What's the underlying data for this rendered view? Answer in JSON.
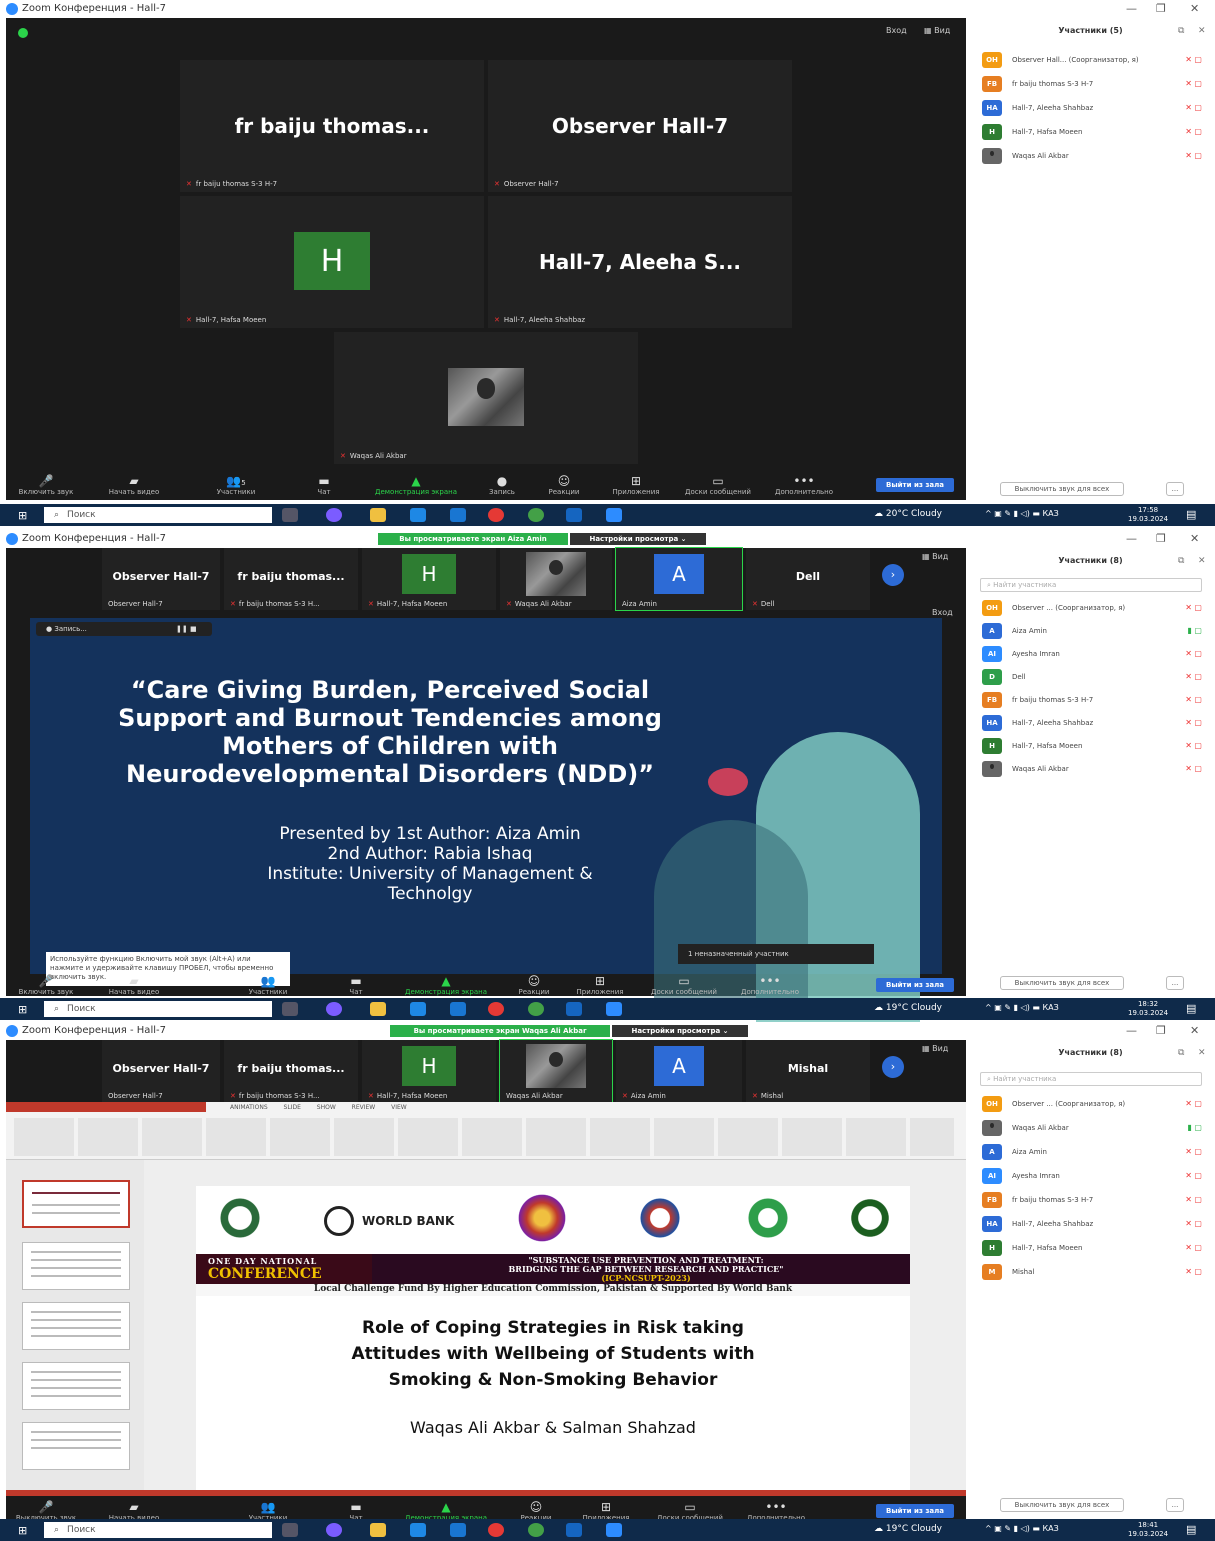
{
  "panels": [
    {
      "window_title": "Zoom Конференция - Hall-7",
      "top_right": {
        "enter": "Вход",
        "view": "Вид"
      },
      "tiles": [
        {
          "big": "fr  baiju thomas...",
          "caption": "fr baiju thomas  S-3 H-7"
        },
        {
          "big": "Observer Hall-7",
          "caption": "Observer Hall-7"
        },
        {
          "avatar": "H",
          "caption": "Hall-7, Hafsa Moeen"
        },
        {
          "big": "Hall-7, Aleeha S...",
          "caption": "Hall-7, Aleeha Shahbaz"
        },
        {
          "photo": true,
          "caption": "Waqas Ali Akbar"
        }
      ],
      "toolbar": {
        "items": [
          "Включить звук",
          "Начать видео",
          "Участники",
          "Чат",
          "Демонстрация экрана",
          "Запись",
          "Реакции",
          "Приложения",
          "Доски сообщений",
          "Дополнительно"
        ],
        "participants_count": "5",
        "leave": "Выйти из зала"
      },
      "sidebar": {
        "title": "Участники (5)",
        "participants": [
          {
            "initials": "OH",
            "color": "#f39c12",
            "name": "Observer Hall... (Соорганизатор, я)"
          },
          {
            "initials": "FB",
            "color": "#e67e22",
            "name": "fr baiju thomas  S-3 H-7"
          },
          {
            "initials": "HA",
            "color": "#2d6bd6",
            "name": "Hall-7, Aleeha Shahbaz"
          },
          {
            "initials": "H",
            "color": "#2e7d32",
            "name": "Hall-7, Hafsa Moeen"
          },
          {
            "initials": "",
            "color": "#666",
            "name": "Waqas Ali Akbar"
          }
        ],
        "mute_all": "Выключить звук для всех",
        "more": "..."
      },
      "taskbar": {
        "search": "Поиск",
        "weather": "20°C  Cloudy",
        "lang": "КАЗ",
        "time": "17:58",
        "date": "19.03.2024"
      }
    },
    {
      "window_title": "Zoom Конференция - Hall-7",
      "viewing_banner": "Вы просматриваете экран Aiza Amin",
      "view_options": "Настройки просмотра",
      "view": "Вид",
      "strip": [
        {
          "name": "Observer Hall-7",
          "caption": "Observer Hall-7"
        },
        {
          "name": "fr  baiju thomas...",
          "caption": "fr baiju thomas  S-3 H..."
        },
        {
          "avatar": "H",
          "caption": "Hall-7, Hafsa Moeen"
        },
        {
          "photo": true,
          "caption": "Waqas Ali Akbar"
        },
        {
          "avatar": "A",
          "caption": "Aiza Amin"
        },
        {
          "name": "Dell",
          "caption": "Dell"
        }
      ],
      "recording": "Запись...",
      "enter": "Вход",
      "slide": {
        "lines": [
          "“Care Giving Burden, Perceived Social",
          "Support and Burnout Tendencies among",
          "Mothers of Children with",
          "Neurodevelopmental Disorders (NDD)”"
        ],
        "sub": [
          "Presented by 1st Author: Aiza Amin",
          "2nd Author: Rabia Ishaq",
          "Institute: University of Management &",
          "Technolgy"
        ]
      },
      "hint": "Используйте функцию Включить мой звук (Alt+A) или нажмите и удерживайте клавишу ПРОБЕЛ, чтобы временно включить звук.",
      "unassigned": "1 неназначенный участник",
      "toolbar": {
        "items": [
          "Включить звук",
          "Начать видео",
          "Участники",
          "Чат",
          "Демонстрация экрана",
          "Реакции",
          "Приложения",
          "Доски сообщений",
          "Дополнительно"
        ],
        "leave": "Выйти из зала"
      },
      "sidebar": {
        "title": "Участники (8)",
        "search": "Найти участника",
        "participants": [
          {
            "initials": "OH",
            "color": "#f39c12",
            "name": "Observer ... (Соорганизатор, я)"
          },
          {
            "initials": "A",
            "color": "#2d6bd6",
            "name": "Aiza Amin"
          },
          {
            "initials": "AI",
            "color": "#2d8cff",
            "name": "Ayesha Imran"
          },
          {
            "initials": "D",
            "color": "#2e9e4a",
            "name": "Dell"
          },
          {
            "initials": "FB",
            "color": "#e67e22",
            "name": "fr baiju thomas  S-3 H-7"
          },
          {
            "initials": "HA",
            "color": "#2d6bd6",
            "name": "Hall-7, Aleeha Shahbaz"
          },
          {
            "initials": "H",
            "color": "#2e7d32",
            "name": "Hall-7, Hafsa Moeen"
          },
          {
            "initials": "",
            "color": "#666",
            "name": "Waqas Ali Akbar"
          }
        ],
        "mute_all": "Выключить звук для всех",
        "more": "..."
      },
      "taskbar": {
        "search": "Поиск",
        "weather": "19°C  Cloudy",
        "lang": "КАЗ",
        "time": "18:32",
        "date": "19.03.2024"
      }
    },
    {
      "window_title": "Zoom Конференция - Hall-7",
      "viewing_banner": "Вы просматриваете экран Waqas Ali Akbar",
      "view_options": "Настройки просмотра",
      "view": "Вид",
      "strip": [
        {
          "name": "Observer Hall-7",
          "caption": "Observer Hall-7"
        },
        {
          "name": "fr  baiju thomas...",
          "caption": "fr baiju thomas  S-3 H..."
        },
        {
          "avatar": "H",
          "caption": "Hall-7, Hafsa Moeen"
        },
        {
          "photo": true,
          "caption": "Waqas Ali Akbar"
        },
        {
          "avatar": "A",
          "caption": "Aiza Amin"
        },
        {
          "name": "Mishal",
          "caption": "Mishal"
        }
      ],
      "ppt_tabs": "ANIMATIONS SLIDE SHOW REVIEW VIEW",
      "slide": {
        "logo_text": "WORLD BANK",
        "conf_a": "ONE DAY NATIONAL",
        "conf_b": "CONFERENCE",
        "conf_r1": "\"SUBSTANCE USE PREVENTION AND TREATMENT:",
        "conf_r2": "BRIDGING THE GAP BETWEEN RESEARCH AND PRACTICE\"",
        "conf_r3": "(ICP-NCSUPT-2023)",
        "fund": "Local Challenge Fund By Higher Education Commission, Pakistan & Supported By World Bank",
        "title": [
          "Role of Coping Strategies in Risk taking",
          "Attitudes with Wellbeing of Students with",
          "Smoking & Non-Smoking Behavior"
        ],
        "authors": "Waqas Ali Akbar & Salman Shahzad"
      },
      "toolbar": {
        "items": [
          "Выключить звук",
          "Начать видео",
          "Участники",
          "Чат",
          "Демонстрация экрана",
          "Реакции",
          "Приложения",
          "Доски сообщений",
          "Дополнительно"
        ],
        "leave": "Выйти из зала"
      },
      "sidebar": {
        "title": "Участники (8)",
        "search": "Найти участника",
        "participants": [
          {
            "initials": "OH",
            "color": "#f39c12",
            "name": "Observer ... (Соорганизатор, я)"
          },
          {
            "initials": "",
            "color": "#666",
            "name": "Waqas Ali Akbar"
          },
          {
            "initials": "A",
            "color": "#2d6bd6",
            "name": "Aiza Amin"
          },
          {
            "initials": "AI",
            "color": "#2d8cff",
            "name": "Ayesha Imran"
          },
          {
            "initials": "FB",
            "color": "#e67e22",
            "name": "fr baiju thomas  S-3 H-7"
          },
          {
            "initials": "HA",
            "color": "#2d6bd6",
            "name": "Hall-7, Aleeha Shahbaz"
          },
          {
            "initials": "H",
            "color": "#2e7d32",
            "name": "Hall-7, Hafsa Moeen"
          },
          {
            "initials": "M",
            "color": "#e67e22",
            "name": "Mishal"
          }
        ],
        "mute_all": "Выключить звук для всех",
        "more": "..."
      },
      "taskbar": {
        "search": "Поиск",
        "weather": "19°C  Cloudy",
        "lang": "КАЗ",
        "time": "18:41",
        "date": "19.03.2024"
      }
    }
  ]
}
